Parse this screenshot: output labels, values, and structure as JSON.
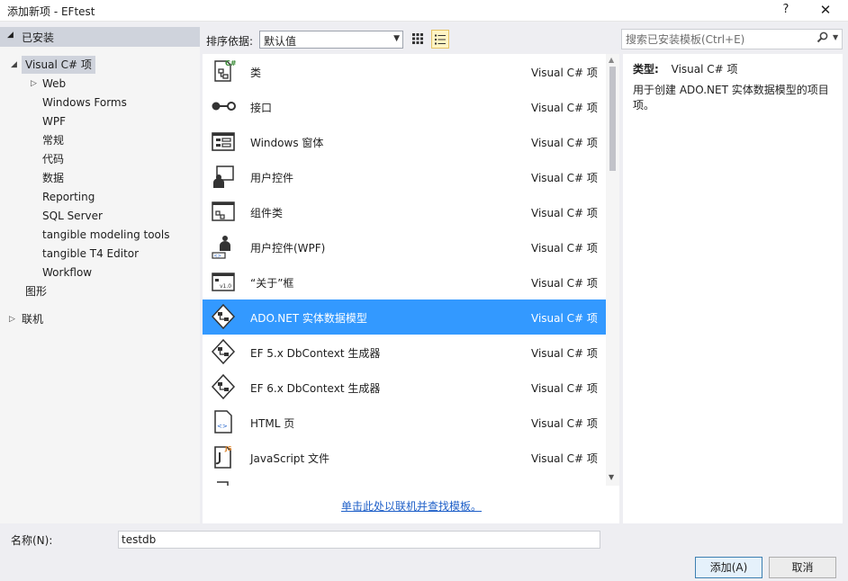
{
  "window": {
    "title": "添加新项 - EFtest",
    "help_label": "?",
    "close_label": "✕"
  },
  "left_panel": {
    "header_label": "已安装",
    "tree": [
      {
        "label": "Visual C# 项",
        "arrow": "◢",
        "selected": true
      },
      {
        "label": "Web",
        "arrow": "▷"
      },
      {
        "label": "Windows Forms"
      },
      {
        "label": "WPF"
      },
      {
        "label": "常规"
      },
      {
        "label": "代码"
      },
      {
        "label": "数据"
      },
      {
        "label": "Reporting"
      },
      {
        "label": "SQL Server"
      },
      {
        "label": "tangible modeling tools"
      },
      {
        "label": "tangible T4 Editor"
      },
      {
        "label": "Workflow"
      },
      {
        "label": "图形"
      },
      {
        "label": "联机",
        "arrow": "▷"
      }
    ]
  },
  "toolbar": {
    "sort_label": "排序依据:",
    "sort_value": "默认值",
    "view_grid_icon": "grid-view-icon",
    "view_list_icon": "list-view-icon"
  },
  "search": {
    "placeholder": "搜索已安装模板(Ctrl+E)"
  },
  "templates": [
    {
      "name": "类",
      "type": "Visual C# 项",
      "icon": "class-icon"
    },
    {
      "name": "接口",
      "type": "Visual C# 项",
      "icon": "interface-icon"
    },
    {
      "name": "Windows 窗体",
      "type": "Visual C# 项",
      "icon": "windows-form-icon"
    },
    {
      "name": "用户控件",
      "type": "Visual C# 项",
      "icon": "user-control-icon"
    },
    {
      "name": "组件类",
      "type": "Visual C# 项",
      "icon": "component-class-icon"
    },
    {
      "name": "用户控件(WPF)",
      "type": "Visual C# 项",
      "icon": "wpf-user-control-icon"
    },
    {
      "name": "“关于”框",
      "type": "Visual C# 项",
      "icon": "about-box-icon"
    },
    {
      "name": "ADO.NET 实体数据模型",
      "type": "Visual C# 项",
      "icon": "entity-model-icon",
      "selected": true
    },
    {
      "name": "EF 5.x DbContext 生成器",
      "type": "Visual C# 项",
      "icon": "entity-model-icon"
    },
    {
      "name": "EF 6.x DbContext 生成器",
      "type": "Visual C# 项",
      "icon": "entity-model-icon"
    },
    {
      "name": "HTML 页",
      "type": "Visual C# 项",
      "icon": "html-page-icon"
    },
    {
      "name": "JavaScript 文件",
      "type": "Visual C# 项",
      "icon": "javascript-file-icon"
    }
  ],
  "online_link": "单击此处以联机并查找模板。",
  "details": {
    "type_label": "类型:",
    "type_value": "Visual C# 项",
    "description": "用于创建 ADO.NET 实体数据模型的项目项。"
  },
  "bottom": {
    "name_label": "名称(N):",
    "name_value": "testdb",
    "add_label": "添加(A)",
    "cancel_label": "取消"
  },
  "colors": {
    "selection": "#3399ff",
    "tree_selection": "#cfd3dc",
    "link": "#1e5fc8"
  }
}
